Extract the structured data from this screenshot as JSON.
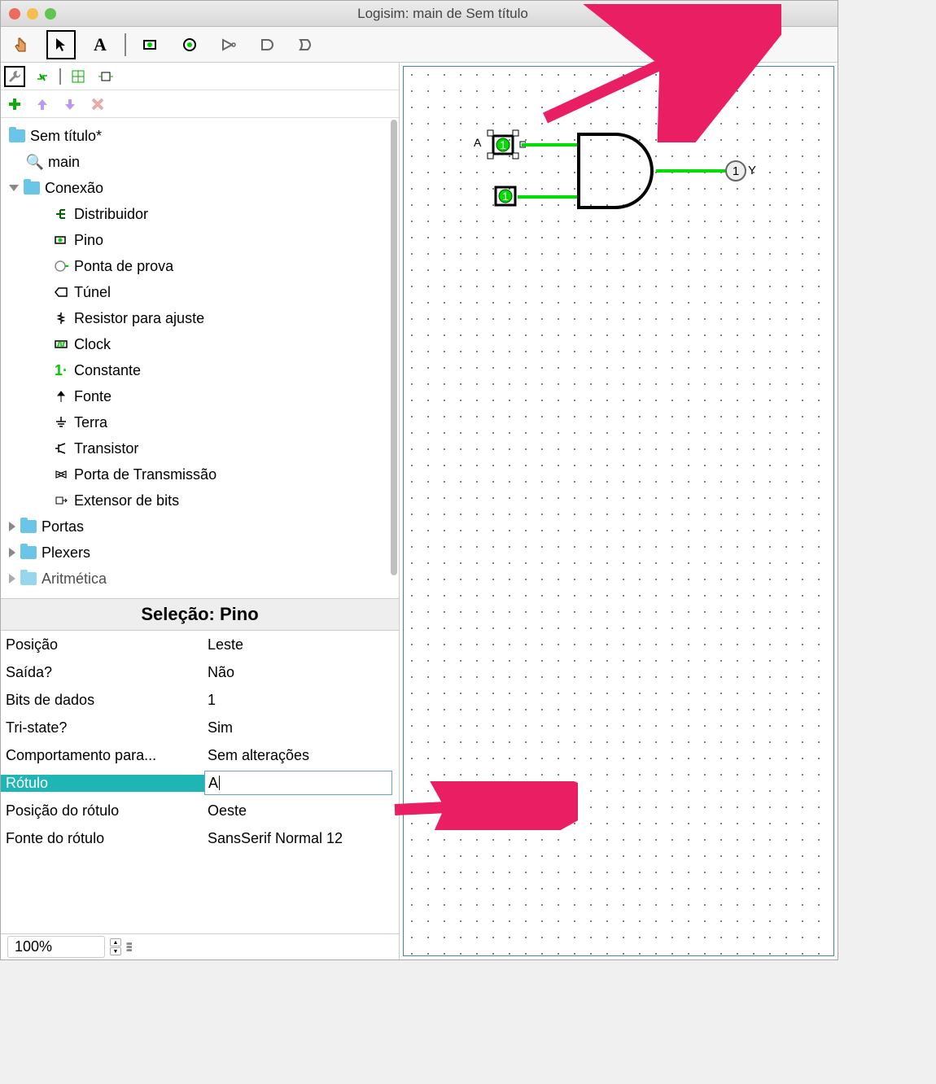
{
  "window": {
    "title": "Logisim: main de Sem título"
  },
  "toolbar": {
    "poke": "☝",
    "select": "↖",
    "text": "A"
  },
  "tree": {
    "root": "Sem título*",
    "main": "main",
    "connFolder": "Conexão",
    "items": [
      "Distribuidor",
      "Pino",
      "Ponta de prova",
      "Túnel",
      "Resistor para ajuste",
      "Clock",
      "Constante",
      "Fonte",
      "Terra",
      "Transistor",
      "Porta de Transmissão",
      "Extensor de bits"
    ],
    "folders": [
      "Portas",
      "Plexers",
      "Aritmética"
    ]
  },
  "propsTitle": "Seleção: Pino",
  "props": [
    {
      "label": "Posição",
      "value": "Leste"
    },
    {
      "label": "Saída?",
      "value": "Não"
    },
    {
      "label": "Bits de dados",
      "value": "1"
    },
    {
      "label": "Tri-state?",
      "value": "Sim"
    },
    {
      "label": "Comportamento para...",
      "value": "Sem alterações"
    },
    {
      "label": "Rótulo",
      "value": "A",
      "selected": true
    },
    {
      "label": "Posição do rótulo",
      "value": "Oeste"
    },
    {
      "label": "Fonte do rótulo",
      "value": "SansSerif Normal 12"
    }
  ],
  "zoom": "100%",
  "canvas": {
    "pinA": {
      "label": "A",
      "value": "1"
    },
    "pinB": {
      "value": "1"
    },
    "output": {
      "label": "Y",
      "value": "1"
    }
  }
}
